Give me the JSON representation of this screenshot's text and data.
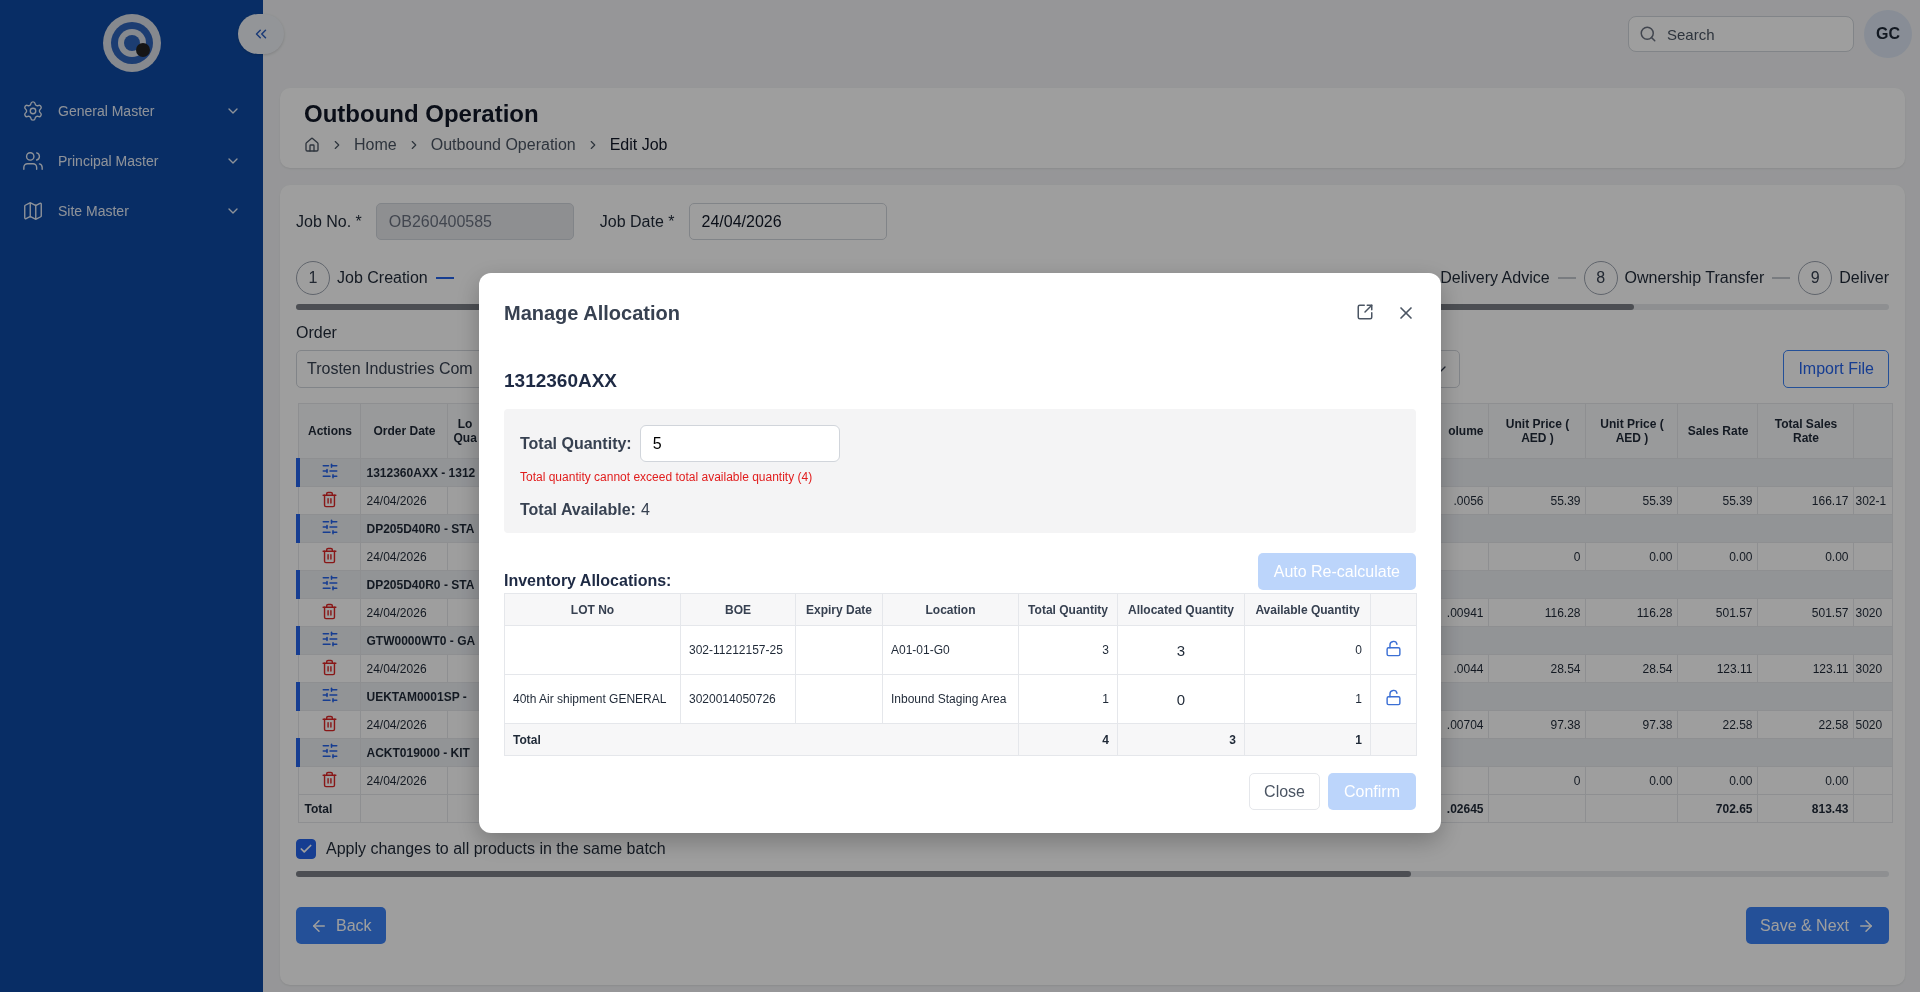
{
  "sidebar": {
    "items": [
      {
        "label": "General Master"
      },
      {
        "label": "Principal Master"
      },
      {
        "label": "Site Master"
      }
    ]
  },
  "topbar": {
    "search": {
      "placeholder": "Search"
    },
    "avatar": "GC"
  },
  "page": {
    "title": "Outbound Operation",
    "breadcrumbs": [
      "Home",
      "Outbound Operation",
      "Edit Job"
    ]
  },
  "job_fields": [
    {
      "label": "Job No. *",
      "value": "OB260400585",
      "disabled": true
    },
    {
      "label": "Job Date *",
      "value": "24/04/2026",
      "disabled": false
    }
  ],
  "stepper": {
    "steps": [
      {
        "number": "1",
        "label": "Job Creation"
      },
      {
        "label": "Delivery Advice"
      },
      {
        "number": "8",
        "label": "Ownership Transfer"
      },
      {
        "number": "9",
        "label": "Deliver"
      }
    ],
    "connectors": [
      {
        "active": true
      },
      {
        "active": false
      },
      {
        "active": false
      }
    ]
  },
  "order": {
    "label": "Order",
    "value": "Trosten Industries Com",
    "import_button": "Import File"
  },
  "table": {
    "left_columns": [
      "Actions",
      "Order Date",
      "Lo Qua"
    ],
    "right_columns": [
      "olume",
      "Unit Price ( AED )",
      "Unit Price ( AED )",
      "Sales Rate",
      "Total Sales Rate"
    ],
    "rows": [
      {
        "group": "1312360AXX - 1312",
        "date": "24/04/2026",
        "volume": ".0056",
        "unit_price_1": "55.39",
        "unit_price_2": "55.39",
        "sales_rate": "55.39",
        "total_sales_rate": "166.17",
        "column_10": "302-1"
      },
      {
        "group": "DP205D40R0 - STA",
        "date": "24/04/2026",
        "unit_price_1": "0",
        "unit_price_2": "0.00",
        "sales_rate": "0.00",
        "total_sales_rate": "0.00"
      },
      {
        "group": "DP205D40R0 - STA",
        "date": "24/04/2026",
        "volume": ".00941",
        "unit_price_1": "116.28",
        "unit_price_2": "116.28",
        "sales_rate": "501.57",
        "total_sales_rate": "501.57",
        "column_10": "3020"
      },
      {
        "group": "GTW0000WT0 - GA",
        "date": "24/04/2026",
        "volume": ".0044",
        "unit_price_1": "28.54",
        "unit_price_2": "28.54",
        "sales_rate": "123.11",
        "total_sales_rate": "123.11",
        "column_10": "3020"
      },
      {
        "group": "UEKTAM0001SP -",
        "date": "24/04/2026",
        "volume": ".00704",
        "unit_price_1": "97.38",
        "unit_price_2": "97.38",
        "sales_rate": "22.58",
        "total_sales_rate": "22.58",
        "column_10": "5020"
      },
      {
        "group": "ACKT019000 - KIT",
        "date": "24/04/2026",
        "unit_price_1": "0",
        "unit_price_2": "0.00",
        "sales_rate": "0.00",
        "total_sales_rate": "0.00"
      }
    ],
    "total": {
      "label": "Total",
      "volume": ".02645",
      "sales_rate": "702.65",
      "total_sales_rate": "813.43"
    }
  },
  "apply_all": {
    "label": "Apply changes to all products in the same batch",
    "checked": true
  },
  "nav_buttons": {
    "back": "Back",
    "next": "Save & Next"
  },
  "modal": {
    "title": "Manage Allocation",
    "item_code": "1312360AXX",
    "total_quantity": {
      "label": "Total Quantity:",
      "value": "5",
      "error": "Total quantity cannot exceed total available quantity (4)"
    },
    "total_available": {
      "label": "Total Available:",
      "value": "4"
    },
    "allocations": {
      "title": "Inventory Allocations:",
      "recalc_button": {
        "label": "Auto Re-calculate",
        "disabled": true
      },
      "columns": [
        "LOT No",
        "BOE",
        "Expiry Date",
        "Location",
        "Total Quantity",
        "Allocated Quantity",
        "Available Quantity"
      ],
      "rows": [
        {
          "boe": "302-11212157-25",
          "location": "A01-01-G0",
          "total": "3",
          "allocated": "3",
          "available": "0",
          "locked": false
        },
        {
          "lot": "40th Air shipment GENERAL",
          "boe": "3020014050726",
          "location": "Inbound Staging Area",
          "total": "1",
          "allocated": "0",
          "available": "1",
          "locked": false
        }
      ],
      "total": {
        "label": "Total",
        "total": "4",
        "allocated": "3",
        "available": "1"
      }
    },
    "buttons": [
      {
        "label": "Close",
        "kind": "secondary",
        "disabled": false
      },
      {
        "label": "Confirm",
        "kind": "primary",
        "disabled": true
      }
    ]
  }
}
